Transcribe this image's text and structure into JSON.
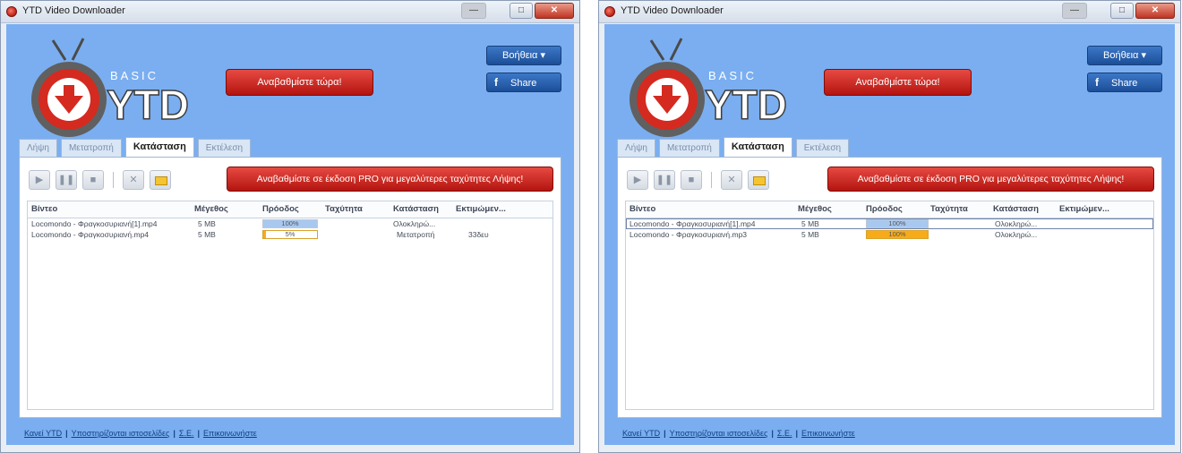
{
  "app": {
    "title": "YTD Video Downloader",
    "logo_basic": "BASIC",
    "logo_ytd": "YTD",
    "upgrade_now": "Αναβαθμίστε τώρα!",
    "help": "Βοήθεια ▾",
    "share": "Share",
    "tabs": [
      "Λήψη",
      "Μετατροπή",
      "Κατάσταση",
      "Εκτέλεση"
    ],
    "pro_banner": "Αναβαθμίστε σε έκδοση PRO για μεγαλύτερες ταχύτητες Λήψης!",
    "columns": [
      "Βίντεο",
      "Μέγεθος",
      "Πρόοδος",
      "Ταχύτητα",
      "Κατάσταση",
      "Εκτιμώμεν..."
    ],
    "footer_links": [
      "Κανεί YTD",
      "Υποστηρίζονται ιστοσελίδες",
      "Σ.Ε.",
      "Επικοινωνήστε"
    ],
    "colors": {
      "progress_blue": "#a9c8f0",
      "progress_orange": "#f7ab1b",
      "accent_red": "#c41f18",
      "window_blue": "#7aaef0"
    }
  },
  "left_window": {
    "active_tab": 2,
    "rows": [
      {
        "video": "Locomondo - Φραγκοσυριανή[1].mp4",
        "size": "5 MB",
        "progress_text": "100%",
        "progress": 1.0,
        "fill": "blue",
        "speed": "",
        "status": "Ολοκληρώ...",
        "eta": ""
      },
      {
        "video": "Locomondo - Φραγκοσυριανή.mp4",
        "size": "5 MB",
        "progress_text": "5%",
        "progress": 0.05,
        "fill": "orange",
        "speed": "",
        "status": "Μετατροπή",
        "eta": "33δευ"
      }
    ]
  },
  "right_window": {
    "active_tab": 2,
    "rows": [
      {
        "video": "Locomondo - Φραγκοσυριανή[1].mp4",
        "size": "5 MB",
        "progress_text": "100%",
        "progress": 1.0,
        "fill": "blue",
        "speed": "",
        "status": "Ολοκληρώ...",
        "eta": ""
      },
      {
        "video": "Locomondo - Φραγκοσυριανή.mp3",
        "size": "5 MB",
        "progress_text": "100%",
        "progress": 1.0,
        "fill": "orange",
        "speed": "",
        "status": "Ολοκληρώ...",
        "eta": ""
      }
    ]
  }
}
